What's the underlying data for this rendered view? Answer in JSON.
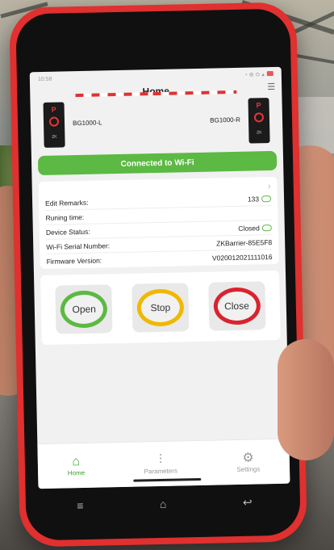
{
  "status_bar": {
    "time": "10:58",
    "right": "◔ ⊗ ⊙ ▴"
  },
  "header": {
    "title": "Home"
  },
  "barriers": {
    "left_label": "BG1000-L",
    "right_label": "BG1000-R",
    "gate_letter": "P"
  },
  "wifi": {
    "label": "Connected to Wi-Fi"
  },
  "info": {
    "rows": [
      {
        "label": "Edit Remarks:",
        "value": "133"
      },
      {
        "label": "Runing time:",
        "value": ""
      },
      {
        "label": "Device Status:",
        "value": "Closed"
      },
      {
        "label": "Wi-Fi Serial Number:",
        "value": "ZKBarrier-85E5F8"
      },
      {
        "label": "Firmware Version:",
        "value": "V020012021111016"
      }
    ]
  },
  "controls": {
    "open": "Open",
    "stop": "Stop",
    "close": "Close"
  },
  "tabs": [
    {
      "label": "Home",
      "icon": "home-icon"
    },
    {
      "label": "Parameters",
      "icon": "sliders-icon"
    },
    {
      "label": "Settings",
      "icon": "gear-icon"
    }
  ],
  "colors": {
    "accent": "#5cb943",
    "stop": "#f0b800",
    "close": "#d9232e",
    "phone": "#e0302f"
  }
}
